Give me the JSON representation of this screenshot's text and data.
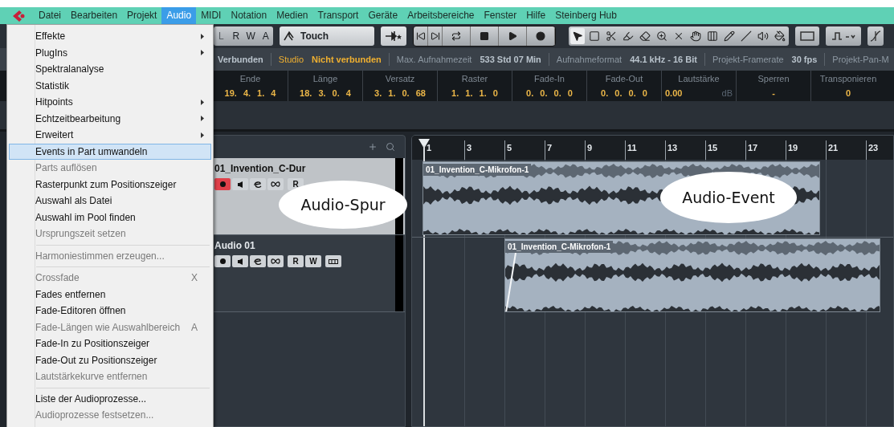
{
  "menu_bar": {
    "items": [
      {
        "label": "Datei",
        "selected": false
      },
      {
        "label": "Bearbeiten",
        "selected": false
      },
      {
        "label": "Projekt",
        "selected": false
      },
      {
        "label": "Audio",
        "selected": true
      },
      {
        "label": "MIDI",
        "selected": false
      },
      {
        "label": "Notation",
        "selected": false
      },
      {
        "label": "Medien",
        "selected": false
      },
      {
        "label": "Transport",
        "selected": false
      },
      {
        "label": "Geräte",
        "selected": false
      },
      {
        "label": "Arbeitsbereiche",
        "selected": false
      },
      {
        "label": "Fenster",
        "selected": false
      },
      {
        "label": "Hilfe",
        "selected": false
      },
      {
        "label": "Steinberg Hub",
        "selected": false
      }
    ]
  },
  "audio_menu": {
    "items": [
      {
        "kind": "item",
        "label": "Effekte",
        "submenu": true,
        "disabled": false,
        "selected": false
      },
      {
        "kind": "item",
        "label": "PlugIns",
        "submenu": true,
        "disabled": false,
        "selected": false
      },
      {
        "kind": "item",
        "label": "Spektralanalyse",
        "submenu": false,
        "disabled": false,
        "selected": false
      },
      {
        "kind": "item",
        "label": "Statistik",
        "submenu": false,
        "disabled": false,
        "selected": false
      },
      {
        "kind": "item",
        "label": "Hitpoints",
        "submenu": true,
        "disabled": false,
        "selected": false
      },
      {
        "kind": "item",
        "label": "Echtzeitbearbeitung",
        "submenu": true,
        "disabled": false,
        "selected": false
      },
      {
        "kind": "item",
        "label": "Erweitert",
        "submenu": true,
        "disabled": false,
        "selected": false
      },
      {
        "kind": "item",
        "label": "Events in Part umwandeln",
        "submenu": false,
        "disabled": false,
        "selected": true
      },
      {
        "kind": "item",
        "label": "Parts auflösen",
        "submenu": false,
        "disabled": true,
        "selected": false
      },
      {
        "kind": "item",
        "label": "Rasterpunkt zum Positionszeiger",
        "submenu": false,
        "disabled": false,
        "selected": false
      },
      {
        "kind": "item",
        "label": "Auswahl als Datei",
        "submenu": false,
        "disabled": false,
        "selected": false
      },
      {
        "kind": "item",
        "label": "Auswahl im Pool finden",
        "submenu": false,
        "disabled": false,
        "selected": false
      },
      {
        "kind": "item",
        "label": "Ursprungszeit setzen",
        "submenu": false,
        "disabled": true,
        "selected": false
      },
      {
        "kind": "separator"
      },
      {
        "kind": "item",
        "label": "Harmoniestimmen erzeugen...",
        "submenu": false,
        "disabled": true,
        "selected": false
      },
      {
        "kind": "separator"
      },
      {
        "kind": "item",
        "label": "Crossfade",
        "shortcut": "X",
        "submenu": false,
        "disabled": true,
        "selected": false
      },
      {
        "kind": "item",
        "label": "Fades entfernen",
        "submenu": false,
        "disabled": false,
        "selected": false
      },
      {
        "kind": "item",
        "label": "Fade-Editoren öffnen",
        "submenu": false,
        "disabled": false,
        "selected": false
      },
      {
        "kind": "item",
        "label": "Fade-Längen wie Auswahlbereich",
        "shortcut": "A",
        "submenu": false,
        "disabled": true,
        "selected": false
      },
      {
        "kind": "item",
        "label": "Fade-In zu Positionszeiger",
        "submenu": false,
        "disabled": false,
        "selected": false
      },
      {
        "kind": "item",
        "label": "Fade-Out zu Positionszeiger",
        "submenu": false,
        "disabled": false,
        "selected": false
      },
      {
        "kind": "item",
        "label": "Lautstärkekurve entfernen",
        "submenu": false,
        "disabled": true,
        "selected": false
      },
      {
        "kind": "separator"
      },
      {
        "kind": "item",
        "label": "Liste der Audioprozesse...",
        "submenu": false,
        "disabled": false,
        "selected": false
      },
      {
        "kind": "item",
        "label": "Audioprozesse festsetzen...",
        "submenu": false,
        "disabled": true,
        "selected": false
      }
    ]
  },
  "toolbar": {
    "automation_buttons": [
      {
        "label": "L",
        "disabled": true
      },
      {
        "label": "R",
        "disabled": false
      },
      {
        "label": "W",
        "disabled": false
      },
      {
        "label": "A",
        "disabled": false
      }
    ],
    "automation_mode": "Touch"
  },
  "status_line": [
    {
      "items": [
        {
          "text": "Verbunden",
          "kind": "status"
        }
      ]
    },
    {
      "items": [
        {
          "text": "Studio",
          "kind": "accent"
        },
        {
          "text": "Nicht verbunden",
          "kind": "accent_bold"
        }
      ]
    },
    {
      "items": [
        {
          "text": "Max. Aufnahmezeit",
          "kind": "label"
        },
        {
          "text": "533 Std 07 Min",
          "kind": "value"
        }
      ]
    },
    {
      "items": [
        {
          "text": "Aufnahmeformat",
          "kind": "label"
        },
        {
          "text": "44.1 kHz - 16 Bit",
          "kind": "value"
        }
      ]
    },
    {
      "items": [
        {
          "text": "Projekt-Framerate",
          "kind": "label"
        },
        {
          "text": "30 fps",
          "kind": "value"
        }
      ]
    },
    {
      "items": [
        {
          "text": "Projekt-Pan-M",
          "kind": "label"
        }
      ]
    }
  ],
  "info_line": [
    {
      "label": "Ende",
      "value": "19. 4. 1. 4"
    },
    {
      "label": "Länge",
      "value": "18. 3. 0. 4"
    },
    {
      "label": "Versatz",
      "value": "3. 1. 0. 68"
    },
    {
      "label": "Raster",
      "value": "1. 1. 1. 0"
    },
    {
      "label": "Fade-In",
      "value": "0. 0. 0. 0"
    },
    {
      "label": "Fade-Out",
      "value": "0. 0. 0. 0"
    },
    {
      "label": "Lautstärke",
      "value": "0.00",
      "unit": "dB"
    },
    {
      "label": "Sperren",
      "value": "-"
    },
    {
      "label": "Transponieren",
      "value": "0"
    }
  ],
  "tracks": [
    {
      "name": "01_Invention_C-Dur",
      "selected": true,
      "record_enabled": true,
      "read_label": "R"
    },
    {
      "name": "Audio 01",
      "selected": false,
      "record_enabled": false,
      "read_label": "R",
      "write_label": "W"
    }
  ],
  "ruler": {
    "labels": [
      "1",
      "3",
      "5",
      "7",
      "9",
      "11",
      "13",
      "15",
      "17",
      "19",
      "21",
      "23"
    ]
  },
  "events": [
    {
      "name": "01_Invention_C-Mikrofon-1",
      "fade_in": false
    },
    {
      "name": "01_Invention_C-Mikrofon-1",
      "fade_in": true
    }
  ],
  "callouts": [
    {
      "text": "Audio-Spur"
    },
    {
      "text": "Audio-Event"
    }
  ]
}
